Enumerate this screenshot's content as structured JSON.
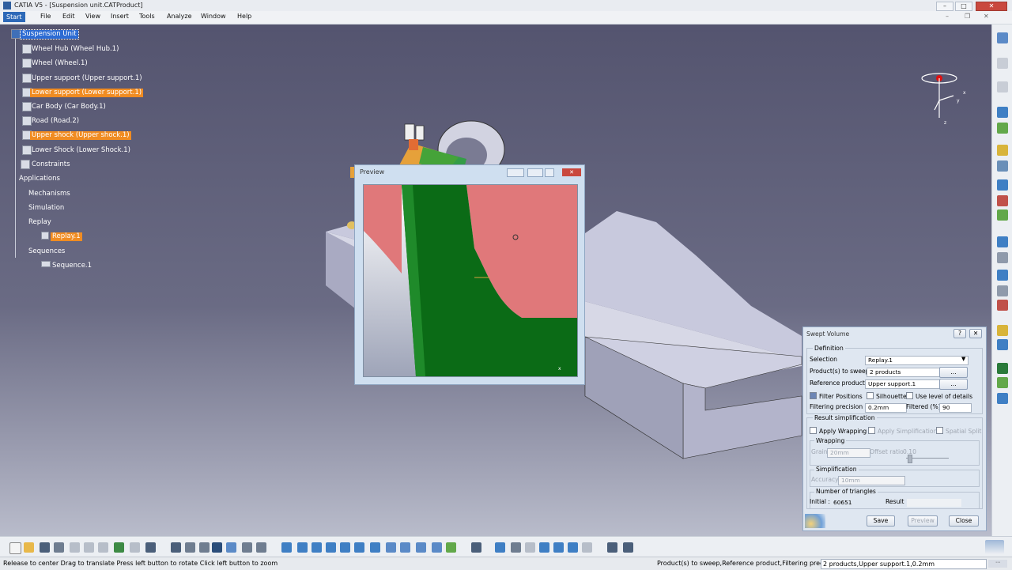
{
  "window": {
    "title": "CATIA V5 - [Suspension unit.CATProduct]"
  },
  "menu": {
    "start": "Start",
    "items": [
      "File",
      "Edit",
      "View",
      "Insert",
      "Tools",
      "Analyze",
      "Window",
      "Help"
    ]
  },
  "tree": {
    "root": "Suspension Unit",
    "products": [
      {
        "label": "Wheel Hub (Wheel Hub.1)",
        "state": "normal"
      },
      {
        "label": "Wheel (Wheel.1)",
        "state": "normal"
      },
      {
        "label": "Upper support (Upper support.1)",
        "state": "normal"
      },
      {
        "label": "Lower support (Lower support.1)",
        "state": "highlight"
      },
      {
        "label": "Car Body (Car Body.1)",
        "state": "normal"
      },
      {
        "label": "Road (Road.2)",
        "state": "normal"
      },
      {
        "label": "Upper shock (Upper shock.1)",
        "state": "highlight"
      },
      {
        "label": "Lower Shock (Lower Shock.1)",
        "state": "normal"
      },
      {
        "label": "Constraints",
        "state": "normal"
      }
    ],
    "applications": "Applications",
    "mechanisms": "Mechanisms",
    "simulation": "Simulation",
    "replay": "Replay",
    "replay_item": "Replay.1",
    "sequences": "Sequences",
    "sequence_item": "Sequence.1"
  },
  "preview": {
    "title": "Preview"
  },
  "dialog": {
    "title": "Swept Volume",
    "definition": "Definition",
    "selection_label": "Selection",
    "selection_value": "Replay.1",
    "products_label": "Product(s) to sweep",
    "products_value": "2 products",
    "reference_label": "Reference product",
    "reference_value": "Upper support.1",
    "browse": "...",
    "filter_positions": "Filter Positions",
    "silhouette": "Silhouette",
    "use_level": "Use level of details",
    "filtering_precision_label": "Filtering precision",
    "filtering_precision_value": "0.2mm",
    "filtered_label": "Filtered (%)",
    "filtered_value": "90",
    "result_simplification": "Result simplification",
    "apply_wrapping": "Apply Wrapping",
    "apply_simplification": "Apply Simplification",
    "spatial_split": "Spatial Split",
    "wrapping": "Wrapping",
    "grain_label": "Grain",
    "grain_value": "20mm",
    "offset_ratio_label": "Offset ratio",
    "offset_ratio_value": "0.10",
    "simplification": "Simplification",
    "accuracy_label": "Accuracy",
    "accuracy_value": "10mm",
    "num_triangles": "Number of triangles",
    "initial_label": "Initial :",
    "initial_value": "60651",
    "result_label": "Result :",
    "result_value": "",
    "save": "Save",
    "preview_btn": "Preview",
    "close": "Close",
    "help": "?",
    "close_x": "✕"
  },
  "status": {
    "left": "Release to center  Drag to translate  Press left button to rotate  Click left button to zoom",
    "right_label": "Product(s) to sweep,Reference product,Filtering precision",
    "right_value": "2 products,Upper support.1,0.2mm"
  },
  "colors": {
    "viewport_top": "#54546f",
    "viewport_bottom": "#b9bccb",
    "highlight": "#f08c22",
    "selection": "#2c6bd3",
    "preview_green": "#0b6b16",
    "preview_pink": "#e0787a"
  }
}
